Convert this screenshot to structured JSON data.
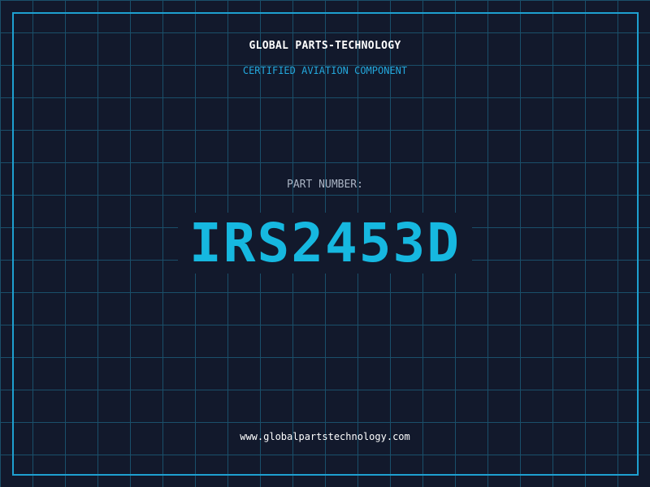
{
  "header": {
    "company": "GLOBAL PARTS-TECHNOLOGY",
    "subtitle": "CERTIFIED AVIATION COMPONENT"
  },
  "part": {
    "label": "PART NUMBER:",
    "number": "IRS2453D"
  },
  "footer": {
    "url": "www.globalpartstechnology.com"
  },
  "colors": {
    "background": "#12192c",
    "grid": "#1a4f6a",
    "accent": "#16b8e0",
    "frame": "#1ea0d0",
    "label": "#aab4c4",
    "text": "#ffffff"
  }
}
